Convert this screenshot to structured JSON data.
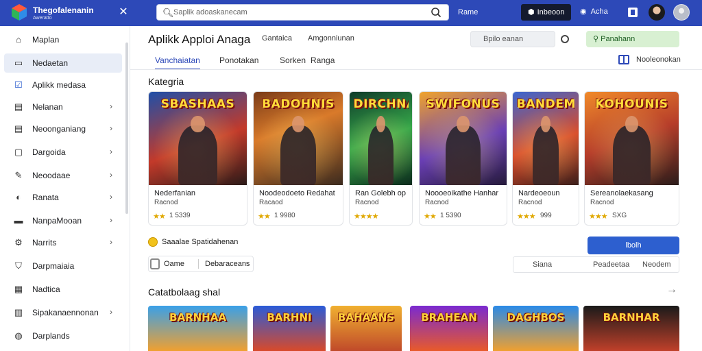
{
  "topbar": {
    "brand_title": "Thegofalenanin",
    "brand_subtitle": "Aweratto",
    "search_placeholder": "Saplik adoaskanecam",
    "link": "Rame",
    "button_label": "Inbeoon",
    "account_label": "Acha"
  },
  "sidebar": {
    "items": [
      {
        "label": "Maplan",
        "icon": "home-icon",
        "chevron": false,
        "active": false
      },
      {
        "label": "Nedaetan",
        "icon": "folder-icon",
        "chevron": false,
        "active": true
      },
      {
        "label": "Aplikk medasa",
        "icon": "checkbox-icon",
        "chevron": false,
        "active": false
      },
      {
        "label": "Nelanan",
        "icon": "menu-icon",
        "chevron": true,
        "active": false
      },
      {
        "label": "Neoonganiang",
        "icon": "list-icon",
        "chevron": true,
        "active": false
      },
      {
        "label": "Dargoida",
        "icon": "document-icon",
        "chevron": true,
        "active": false
      },
      {
        "label": "Neoodaae",
        "icon": "wrench-icon",
        "chevron": true,
        "active": false
      },
      {
        "label": "Ranata",
        "icon": "gear-icon",
        "chevron": true,
        "active": false
      },
      {
        "label": "NanpaMooan",
        "icon": "window-icon",
        "chevron": true,
        "active": false
      },
      {
        "label": "Narrits",
        "icon": "puzzle-icon",
        "chevron": true,
        "active": false
      },
      {
        "label": "Darpmaiaia",
        "icon": "shield-icon",
        "chevron": false,
        "active": false
      },
      {
        "label": "Nadtica",
        "icon": "grid-icon",
        "chevron": false,
        "active": false
      },
      {
        "label": "Sipakanaennonan",
        "icon": "table-icon",
        "chevron": true,
        "active": false
      },
      {
        "label": "Darplands",
        "icon": "circle-icon",
        "chevron": false,
        "active": false
      }
    ]
  },
  "header": {
    "title": "Aplikk Apploi Anaga",
    "link1": "Gantaica",
    "link2": "Amgonniunan",
    "box_label": "Bpilo eanan",
    "green_label": "Panahann",
    "view_label": "Nooleonokan"
  },
  "tabs": [
    {
      "label": "Vanchaiatan",
      "active": true
    },
    {
      "label": "Ponotakan",
      "active": false
    },
    {
      "label": "Sorken",
      "active": false
    },
    {
      "label": "Ranga",
      "active": false
    }
  ],
  "section1": {
    "title": "Kategria"
  },
  "cards": [
    {
      "art_title": "SBASHAAS",
      "name": "Nederfanian",
      "subtitle": "Racnod",
      "stars": "★★",
      "rating": "1 5339"
    },
    {
      "art_title": "BADOHNIS",
      "name": "Noodeodoeto Redahat",
      "subtitle": "Racaod",
      "stars": "★★",
      "rating": "1 9980"
    },
    {
      "art_title": "DIRCHNAS",
      "name": "Ran Golebh op",
      "subtitle": "Racnod",
      "stars": "★★★★",
      "rating": ""
    },
    {
      "art_title": "SWIFONUS",
      "name": "Noooeoikathe Hanhar",
      "subtitle": "Racnod",
      "stars": "★★",
      "rating": "1 5390"
    },
    {
      "art_title": "BANDEM",
      "name": "Nardeoeoun",
      "subtitle": "Racnod",
      "stars": "★★★",
      "rating": "999"
    },
    {
      "art_title": "KOHOUNIS",
      "name": "Sereanolaekasang",
      "subtitle": "Racnod",
      "stars": "★★★",
      "rating": "SXG"
    }
  ],
  "controls": {
    "check_label": "Saaalae Spatidahenan",
    "opt_label1": "Oame",
    "opt_label2": "Debaraceans",
    "blue_button": "lbolh",
    "seg1": "Siana",
    "seg2": "Peadeetaa",
    "seg3": "Neodem"
  },
  "section2": {
    "title": "Catatbolaag shal"
  },
  "bottom_cards": [
    {
      "art_title": "BARNHAA"
    },
    {
      "art_title": "BARHNI"
    },
    {
      "art_title": "BAHAANS"
    },
    {
      "art_title": "BRAHEAN"
    },
    {
      "art_title": "DAGHBOS"
    },
    {
      "art_title": "BARNHAR"
    }
  ],
  "colors": {
    "accent": "#2d49b8",
    "star": "#e0a800",
    "green": "#d8f0d2"
  }
}
